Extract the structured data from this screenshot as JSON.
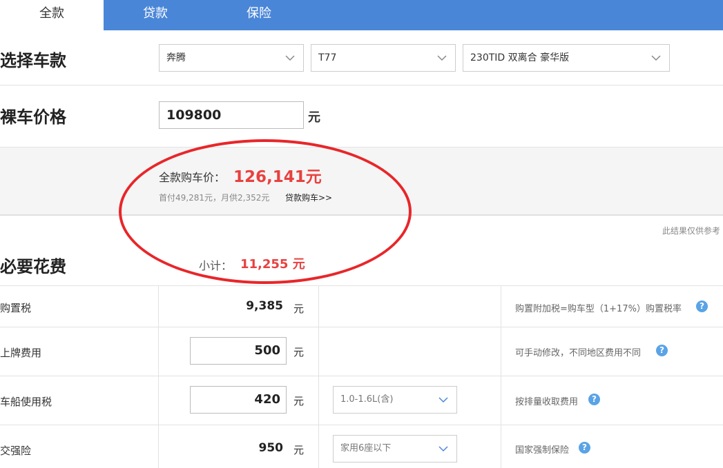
{
  "tabs": [
    {
      "label": "全款"
    },
    {
      "label": "贷款"
    },
    {
      "label": "保险"
    }
  ],
  "select_model": {
    "title": "选择车款",
    "brand": "奔腾",
    "series": "T77",
    "trim": "230TID 双离合 豪华版"
  },
  "bare_price": {
    "title": "裸车价格",
    "value": "109800",
    "unit": "元"
  },
  "summary": {
    "label": "全款购车价：",
    "value": "126,141元",
    "sub": "首付49,281元，月供2,352元",
    "loan_link": "贷款购车>>"
  },
  "note": "此结果仅供参考",
  "necessary": {
    "title": "必要花费",
    "subtotal_label": "小计：",
    "subtotal_value": "11,255 元"
  },
  "rows": [
    {
      "label": "购置税",
      "value": "9,385",
      "unit": "元",
      "note": "购置附加税=购车型（1+17%）购置税率"
    },
    {
      "label": "上牌费用",
      "value": "500",
      "unit": "元",
      "note": "可手动修改，不同地区费用不同"
    },
    {
      "label": "车船使用税",
      "value": "420",
      "unit": "元",
      "option": "1.0-1.6L(含)",
      "note": "按排量收取费用"
    },
    {
      "label": "交强险",
      "value": "950",
      "unit": "元",
      "option": "家用6座以下",
      "note": "国家强制保险"
    }
  ],
  "icons": {
    "help": "help-icon",
    "chevron": "chevron-down-icon"
  },
  "colors": {
    "tab_bar": "#4a86d8",
    "highlight": "#e8413f",
    "annotation": "#e8262a",
    "help": "#5aa3e6"
  }
}
